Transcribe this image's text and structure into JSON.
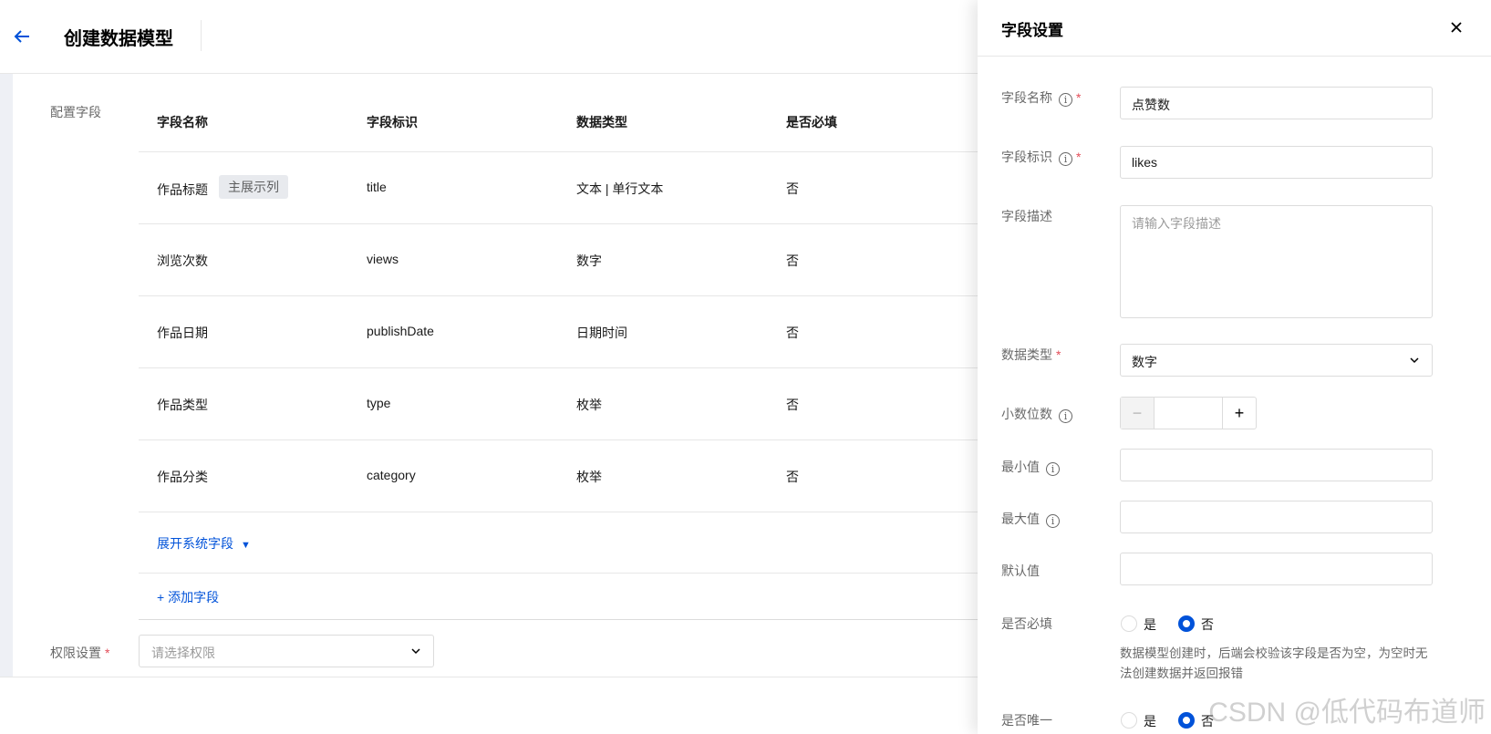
{
  "header": {
    "title": "创建数据模型"
  },
  "main": {
    "section_label": "配置字段",
    "columns": [
      "字段名称",
      "字段标识",
      "数据类型",
      "是否必填"
    ],
    "rows": [
      {
        "name": "作品标题",
        "tag": "主展示列",
        "key": "title",
        "type": "文本 | 单行文本",
        "required": "否"
      },
      {
        "name": "浏览次数",
        "key": "views",
        "type": "数字",
        "required": "否"
      },
      {
        "name": "作品日期",
        "key": "publishDate",
        "type": "日期时间",
        "required": "否"
      },
      {
        "name": "作品类型",
        "key": "type",
        "type": "枚举",
        "required": "否"
      },
      {
        "name": "作品分类",
        "key": "category",
        "type": "枚举",
        "required": "否"
      }
    ],
    "expand_link": "展开系统字段",
    "add_link": "+ 添加字段",
    "permission": {
      "label": "权限设置",
      "placeholder": "请选择权限"
    }
  },
  "drawer": {
    "title": "字段设置",
    "field_name": {
      "label": "字段名称",
      "value": "点赞数"
    },
    "field_key": {
      "label": "字段标识",
      "value": "likes"
    },
    "field_desc": {
      "label": "字段描述",
      "placeholder": "请输入字段描述"
    },
    "data_type": {
      "label": "数据类型",
      "value": "数字"
    },
    "decimals": {
      "label": "小数位数",
      "minus": "−",
      "plus": "+"
    },
    "min": {
      "label": "最小值"
    },
    "max": {
      "label": "最大值"
    },
    "default": {
      "label": "默认值"
    },
    "required": {
      "label": "是否必填",
      "options": [
        "是",
        "否"
      ],
      "selected": "否",
      "hint": "数据模型创建时，后端会校验该字段是否为空，为空时无法创建数据并返回报错"
    },
    "unique": {
      "label": "是否唯一",
      "options": [
        "是",
        "否"
      ],
      "selected": "否"
    }
  },
  "watermark": "CSDN @低代码布道师",
  "colors": {
    "primary": "#0052d9",
    "required_star": "#e34d59"
  }
}
